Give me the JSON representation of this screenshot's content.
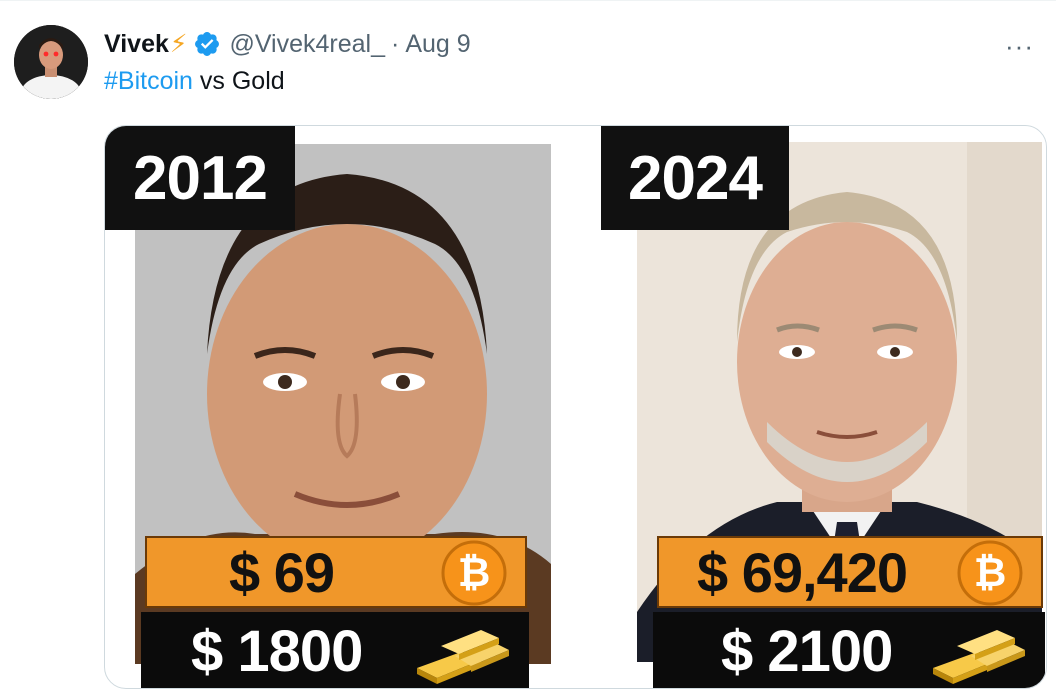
{
  "tweet": {
    "author_name": "Vivek",
    "author_emoji": "⚡",
    "handle": "@Vivek4real_",
    "separator": "·",
    "date": "Aug 9",
    "more_label": "···",
    "text_hashtag": "#Bitcoin",
    "text_rest": " vs Gold",
    "verified_icon": "verified-badge-icon",
    "accent_color": "#1d9bf0"
  },
  "media": {
    "left": {
      "year": "2012",
      "btc_price": "$ 69",
      "gold_price": "$ 1800"
    },
    "right": {
      "year": "2024",
      "btc_price": "$ 69,420",
      "gold_price": "$ 2100"
    },
    "btc_icon": "bitcoin-coin-icon",
    "gold_icon": "gold-bars-icon",
    "bar_color": "#f0972a"
  }
}
